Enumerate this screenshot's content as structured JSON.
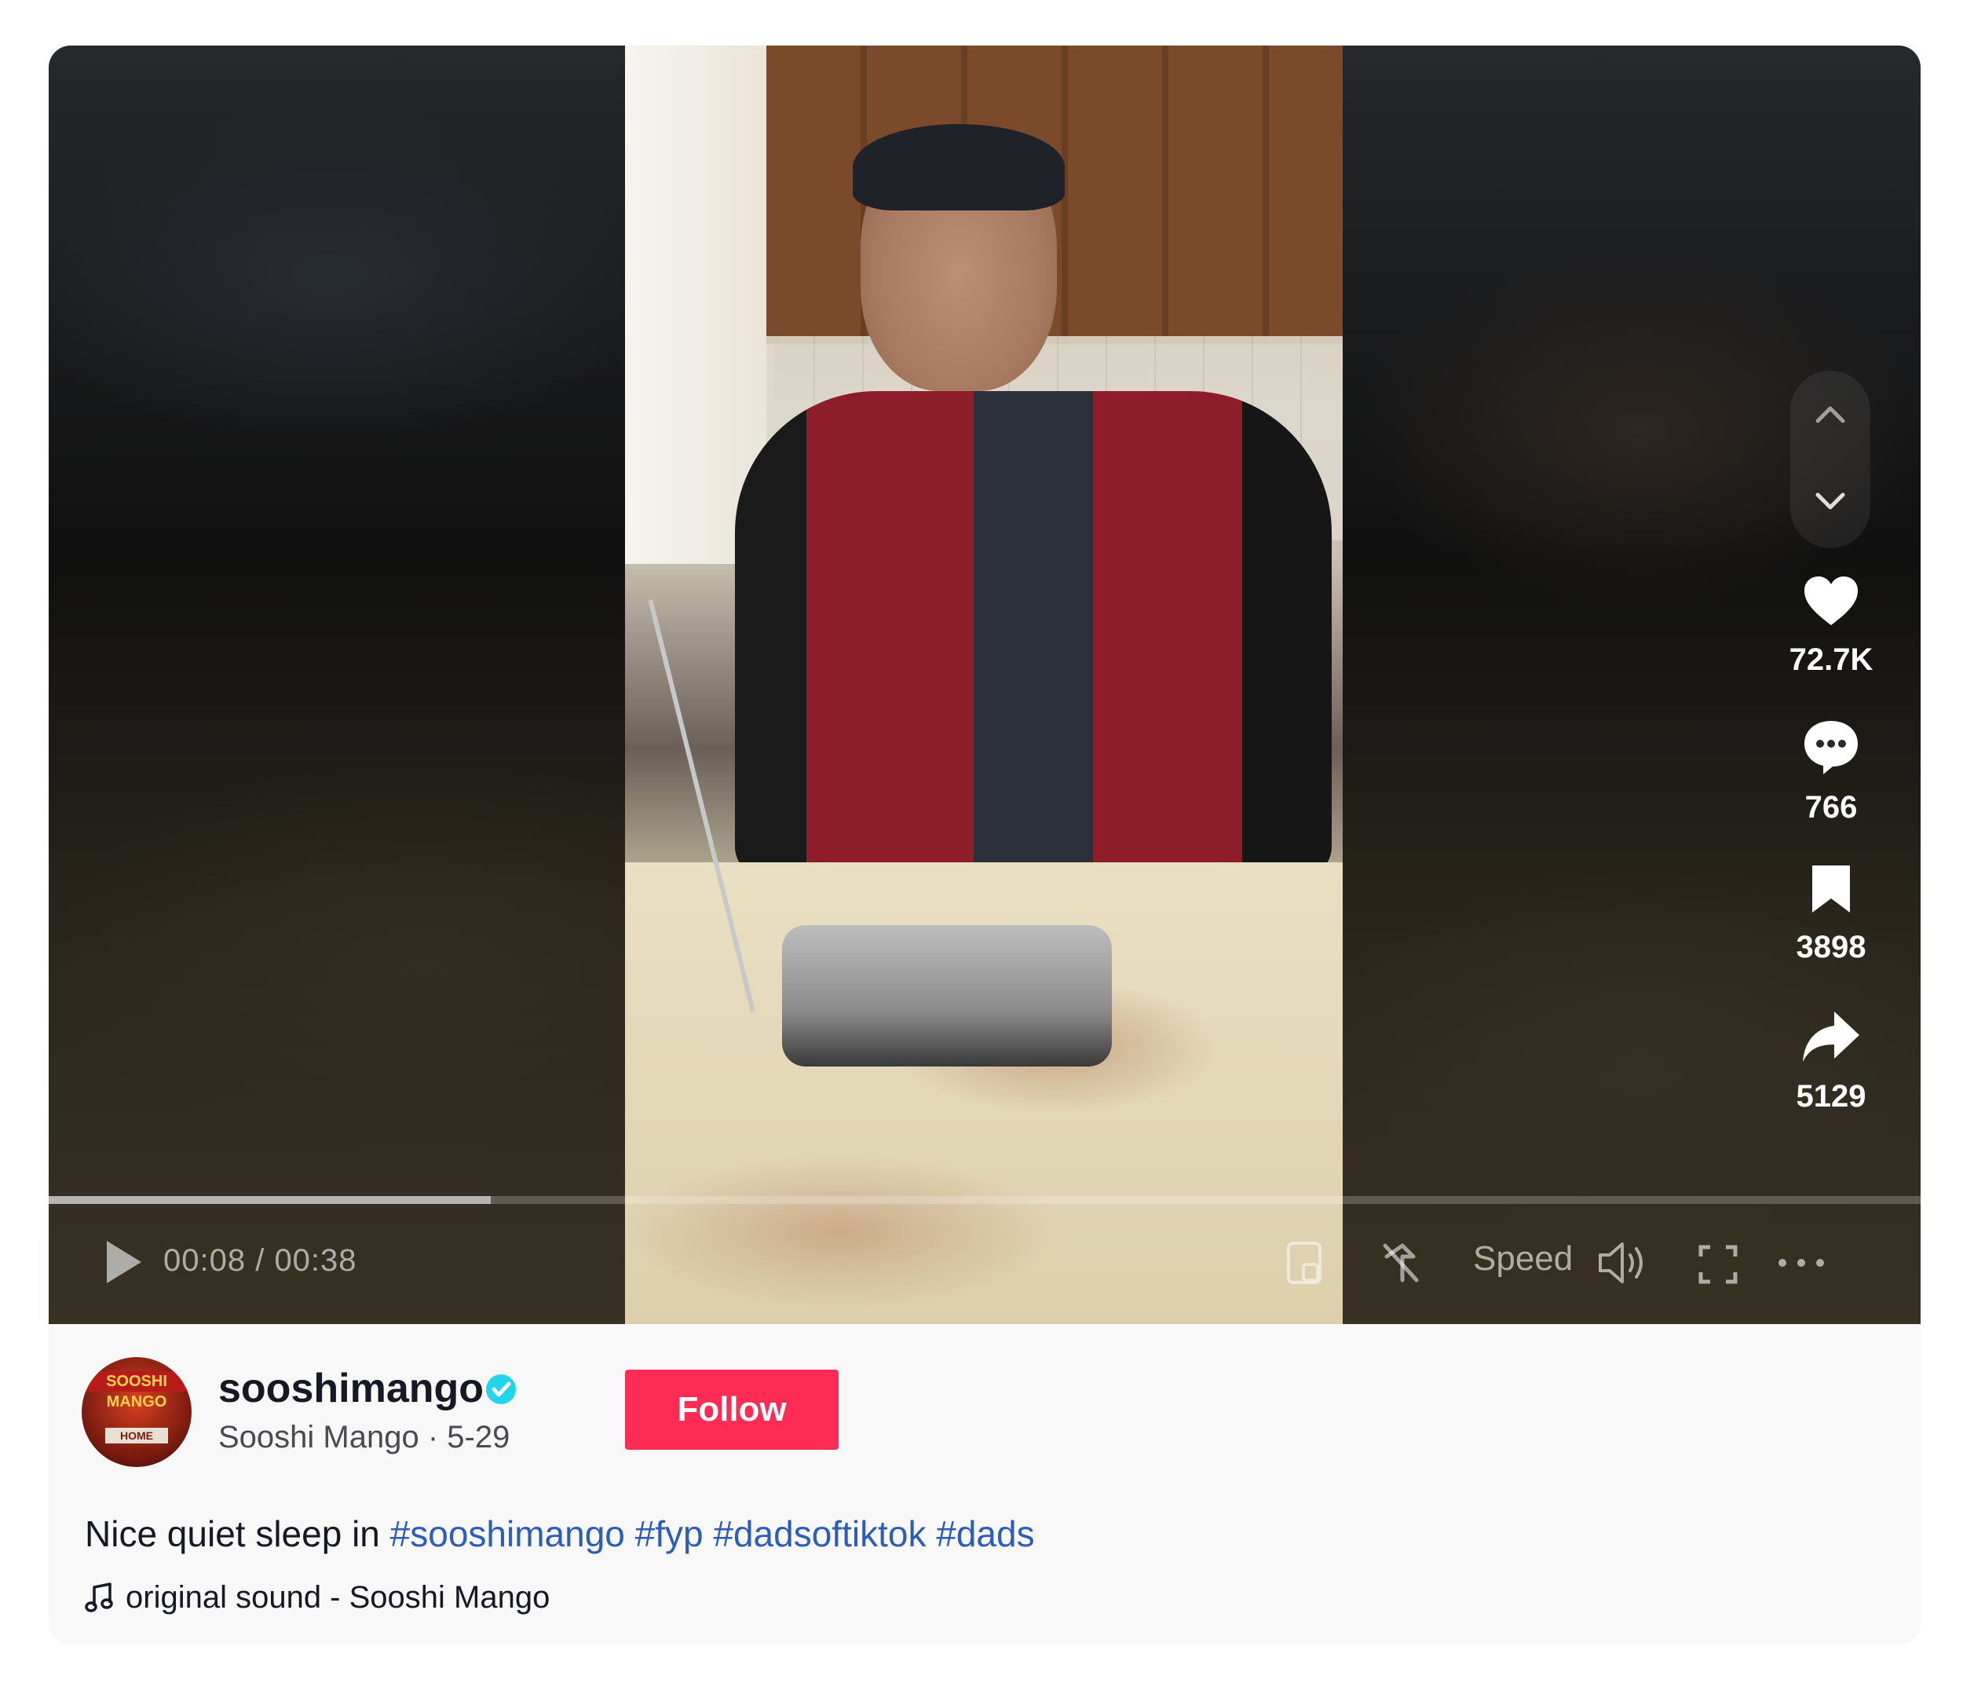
{
  "player": {
    "time": "00:08 / 00:38",
    "progress_fraction": 0.236,
    "speed_label": "Speed"
  },
  "actions": {
    "likes": "72.7K",
    "comments": "766",
    "bookmarks": "3898",
    "shares": "5129"
  },
  "author": {
    "username": "sooshimango",
    "nickname_date": "Sooshi Mango · 5-29",
    "avatar_title": "SOOSHI MANGO",
    "avatar_subtitle": "HOME MADE",
    "verified": true
  },
  "follow_label": "Follow",
  "description": {
    "text": "Nice quiet sleep in",
    "tags": [
      "#sooshimango",
      "#fyp",
      "#dadsoftiktok",
      "#dads"
    ]
  },
  "music": "original sound - Sooshi Mango",
  "colors": {
    "follow": "#fe2c55",
    "hashtag": "#2b5db9",
    "verified": "#20d5ec"
  }
}
